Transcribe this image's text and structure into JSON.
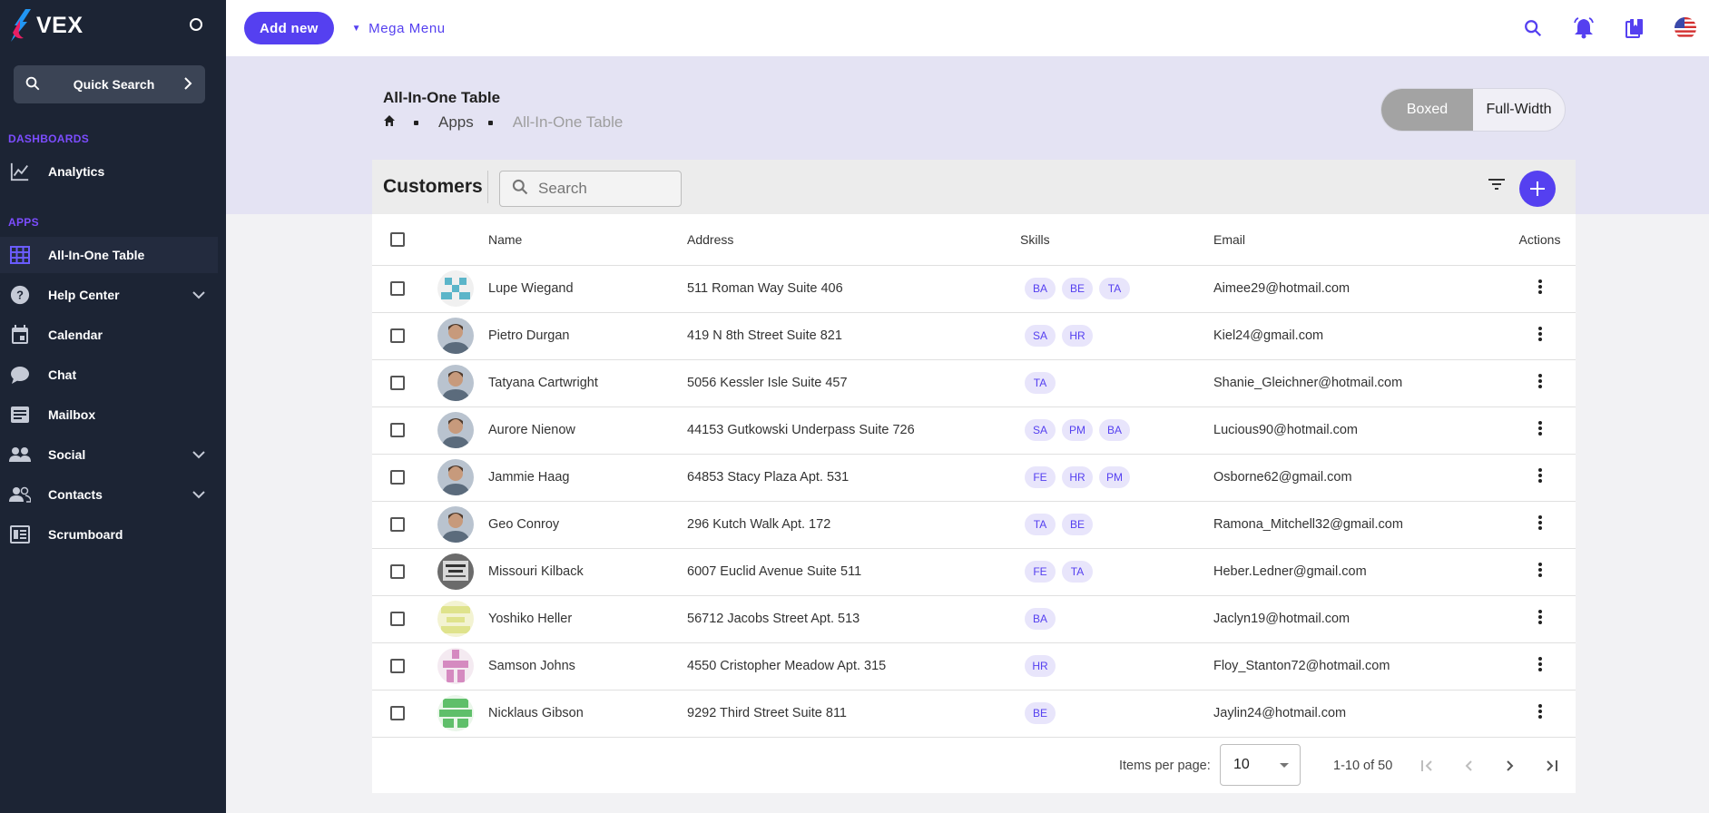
{
  "app": {
    "name": "VEX"
  },
  "sidebar": {
    "quick_search_label": "Quick Search",
    "sections": [
      {
        "heading": "DASHBOARDS"
      },
      {
        "heading": "APPS"
      }
    ],
    "items": [
      {
        "label": "Analytics",
        "icon": "chart-line-icon"
      },
      {
        "label": "All-In-One Table",
        "icon": "table-grid-icon",
        "active": true
      },
      {
        "label": "Help Center",
        "icon": "help-circle-icon",
        "expandable": true
      },
      {
        "label": "Calendar",
        "icon": "calendar-icon"
      },
      {
        "label": "Chat",
        "icon": "chat-bubble-icon"
      },
      {
        "label": "Mailbox",
        "icon": "mailbox-icon"
      },
      {
        "label": "Social",
        "icon": "people-icon",
        "expandable": true
      },
      {
        "label": "Contacts",
        "icon": "contacts-icon",
        "expandable": true
      },
      {
        "label": "Scrumboard",
        "icon": "scrumboard-icon"
      }
    ]
  },
  "topbar": {
    "add_new_label": "Add new",
    "mega_menu_label": "Mega Menu",
    "icons": [
      "search-icon",
      "bell-icon",
      "bookmarks-icon",
      "us-flag-icon"
    ]
  },
  "page": {
    "title": "All-In-One Table",
    "breadcrumb": [
      "Apps",
      "All-In-One Table"
    ],
    "layout_options": [
      "Boxed",
      "Full-Width"
    ],
    "layout_selected": "Boxed"
  },
  "table": {
    "title": "Customers",
    "search_placeholder": "Search",
    "columns": [
      "Name",
      "Address",
      "Skills",
      "Email",
      "Actions"
    ],
    "rows": [
      {
        "name": "Lupe Wiegand",
        "address": "511 Roman Way Suite 406",
        "skills": [
          "BA",
          "BE",
          "TA"
        ],
        "email": "Aimee29@hotmail.com",
        "avatar": "identicon-blue"
      },
      {
        "name": "Pietro Durgan",
        "address": "419 N 8th Street Suite 821",
        "skills": [
          "SA",
          "HR"
        ],
        "email": "Kiel24@gmail.com",
        "avatar": "photo"
      },
      {
        "name": "Tatyana Cartwright",
        "address": "5056 Kessler Isle Suite 457",
        "skills": [
          "TA"
        ],
        "email": "Shanie_Gleichner@hotmail.com",
        "avatar": "photo"
      },
      {
        "name": "Aurore Nienow",
        "address": "44153 Gutkowski Underpass Suite 726",
        "skills": [
          "SA",
          "PM",
          "BA"
        ],
        "email": "Lucious90@hotmail.com",
        "avatar": "photo"
      },
      {
        "name": "Jammie Haag",
        "address": "64853 Stacy Plaza Apt. 531",
        "skills": [
          "FE",
          "HR",
          "PM"
        ],
        "email": "Osborne62@gmail.com",
        "avatar": "photo"
      },
      {
        "name": "Geo Conroy",
        "address": "296 Kutch Walk Apt. 172",
        "skills": [
          "TA",
          "BE"
        ],
        "email": "Ramona_Mitchell32@gmail.com",
        "avatar": "photo"
      },
      {
        "name": "Missouri Kilback",
        "address": "6007 Euclid Avenue Suite 511",
        "skills": [
          "FE",
          "TA"
        ],
        "email": "Heber.Ledner@gmail.com",
        "avatar": "photo-bw"
      },
      {
        "name": "Yoshiko Heller",
        "address": "56712 Jacobs Street Apt. 513",
        "skills": [
          "BA"
        ],
        "email": "Jaclyn19@hotmail.com",
        "avatar": "identicon-yellow"
      },
      {
        "name": "Samson Johns",
        "address": "4550 Cristopher Meadow Apt. 315",
        "skills": [
          "HR"
        ],
        "email": "Floy_Stanton72@hotmail.com",
        "avatar": "identicon-pink"
      },
      {
        "name": "Nicklaus Gibson",
        "address": "9292 Third Street Suite 811",
        "skills": [
          "BE"
        ],
        "email": "Jaylin24@hotmail.com",
        "avatar": "identicon-green"
      }
    ]
  },
  "paginator": {
    "items_per_page_label": "Items per page:",
    "items_per_page": "10",
    "range_label": "1-10 of 50"
  },
  "colors": {
    "accent": "#5540f0",
    "sidebar_bg": "#1c2434",
    "band_bg": "#e4e3f3",
    "chip_bg": "#e8e5fb"
  }
}
